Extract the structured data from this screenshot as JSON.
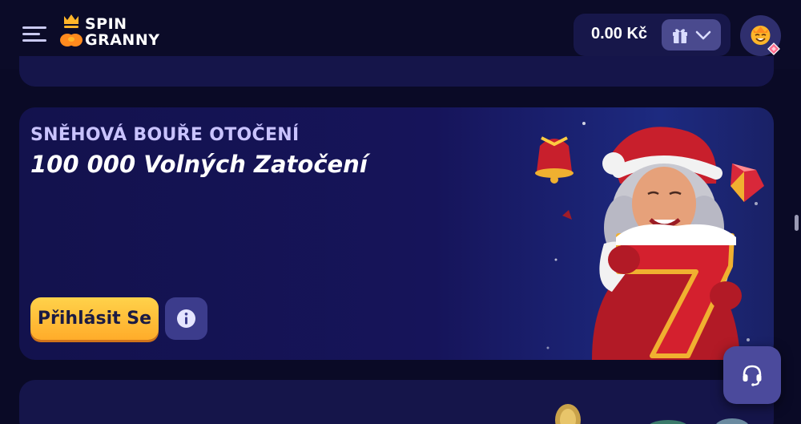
{
  "header": {
    "logo": {
      "line1": "SPIN",
      "line2": "GRANNY"
    },
    "balance": "0.00 Kč",
    "icons": {
      "menu": "hamburger-icon",
      "gift": "gift-icon",
      "dropdown": "chevron-down-icon",
      "avatar": "avatar-face-icon"
    }
  },
  "promo": {
    "subtitle": "SNĚHOVÁ BOUŘE OTOČENÍ",
    "title": "100 000 Volných Zatočení",
    "cta_label": "Přihlásit Se",
    "info_icon": "info-icon"
  },
  "support": {
    "icon": "headset-icon"
  },
  "colors": {
    "background": "#0a0a26",
    "card": "#15154a",
    "accent": "#ffc13a",
    "button_secondary": "#3c3c8c"
  }
}
